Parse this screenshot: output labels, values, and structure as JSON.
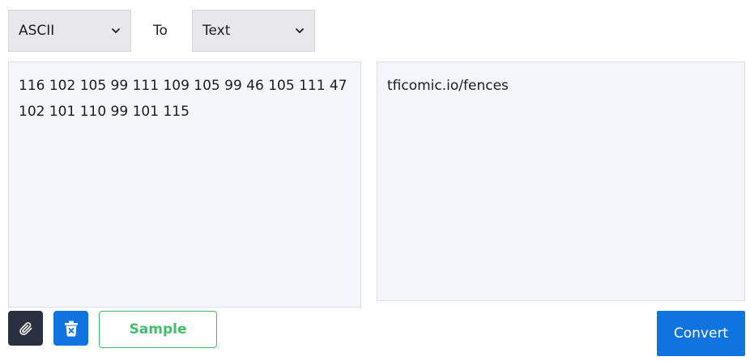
{
  "from_select": {
    "value": "ASCII"
  },
  "to_label": "To",
  "to_select": {
    "value": "Text"
  },
  "input": {
    "value": "116 102 105 99 111 109 105 99 46 105 111 47 102 101 110 99 101 115"
  },
  "output": {
    "value": "tficomic.io/fences"
  },
  "buttons": {
    "sample_label": "Sample",
    "convert_label": "Convert"
  },
  "icons": {
    "attach": "paperclip-icon",
    "clear": "trash-icon",
    "dropdown": "chevron-down-icon"
  },
  "colors": {
    "primary": "#0f73e0",
    "dark_button": "#2b3040",
    "sample_green": "#3fbf6a",
    "panel_bg": "#f3f7fc",
    "select_bg": "#e8e7ec"
  }
}
